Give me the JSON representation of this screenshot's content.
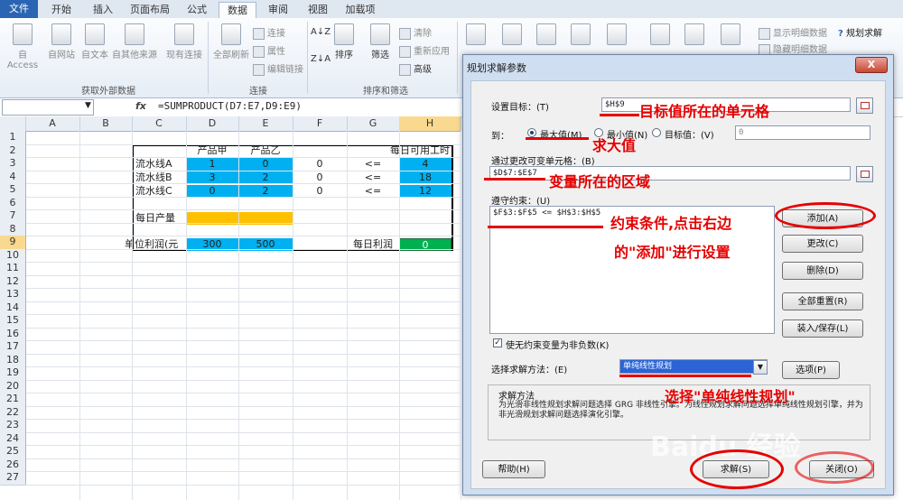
{
  "tabs": [
    "文件",
    "开始",
    "插入",
    "页面布局",
    "公式",
    "数据",
    "审阅",
    "视图",
    "加载项"
  ],
  "ribbon": {
    "get_external": {
      "group": "获取外部数据",
      "items": [
        "自 Access",
        "自网站",
        "自文本",
        "自其他来源",
        "现有连接"
      ]
    },
    "connections": {
      "group": "连接",
      "refresh_all": "全部刷新",
      "items": [
        "连接",
        "属性",
        "编辑链接"
      ]
    },
    "sort_filter": {
      "group": "排序和筛选",
      "sort": "排序",
      "filter": "筛选",
      "items": [
        "清除",
        "重新应用",
        "高级"
      ]
    },
    "outline": {
      "items": [
        "显示明细数据",
        "隐藏明细数据"
      ]
    },
    "solver": "规划求解"
  },
  "formula_bar": {
    "name_box": "",
    "fx": "fx",
    "formula": "=SUMPRODUCT(D7:E7,D9:E9)"
  },
  "columns": [
    "A",
    "B",
    "C",
    "D",
    "E",
    "F",
    "G",
    "H"
  ],
  "rows": [
    "1",
    "2",
    "3",
    "4",
    "5",
    "6",
    "7",
    "8",
    "9",
    "10",
    "11",
    "12",
    "13",
    "14",
    "15",
    "16",
    "17",
    "18",
    "19",
    "20",
    "21",
    "22",
    "23",
    "24",
    "25",
    "26",
    "27"
  ],
  "sheet": {
    "hdr_d": "产品甲",
    "hdr_e": "产品乙",
    "hdr_h": "每日可用工时",
    "line_a": "流水线A",
    "line_b": "流水线B",
    "line_c": "流水线C",
    "d3": "1",
    "e3": "0",
    "f3": "0",
    "g3": "<=",
    "h3": "4",
    "d4": "3",
    "e4": "2",
    "f4": "0",
    "g4": "<=",
    "h4": "18",
    "d5": "0",
    "e5": "2",
    "f5": "0",
    "g5": "<=",
    "h5": "12",
    "daily_output": "每日产量",
    "unit_profit": "单位利润(元",
    "d9": "300",
    "e9": "500",
    "daily_profit": "每日利润",
    "h9": "0"
  },
  "dialog": {
    "title": "规划求解参数",
    "close": "X",
    "target_label": "设置目标：(T)",
    "target_value": "$H$9",
    "to_label": "到：",
    "opt_max": "最大值(M)",
    "opt_min": "最小值(N)",
    "opt_value": "目标值：(V)",
    "value_input": "0",
    "vars_label": "通过更改可变单元格：(B)",
    "vars_value": "$D$7:$E$7",
    "constraints_label": "遵守约束：(U)",
    "constraint_1": "$F$3:$F$5 <= $H$3:$H$5",
    "btn_add": "添加(A)",
    "btn_change": "更改(C)",
    "btn_delete": "删除(D)",
    "btn_reset": "全部重置(R)",
    "btn_load": "装入/保存(L)",
    "nonneg": "使无约束变量为非负数(K)",
    "method_label": "选择求解方法：(E)",
    "method_value": "单纯线性规划",
    "btn_options": "选项(P)",
    "desc_title": "求解方法",
    "desc_text": "为光滑非线性规划求解问题选择 GRG 非线性引擎。为线性规划求解问题选择单纯线性规划引擎，并为非光滑规划求解问题选择演化引擎。",
    "btn_help": "帮助(H)",
    "btn_solve": "求解(S)",
    "btn_close": "关闭(O)"
  },
  "annotations": {
    "target": "目标值所在的单元格",
    "max": "求大值",
    "vars": "变量所在的区域",
    "constraint_1": "约束条件,点击右边",
    "constraint_2": "的\"添加\"进行设置",
    "method": "选择\"单纯线性规划\""
  },
  "watermark": "Baidu 经验",
  "colors": {
    "accent": "#2a64b3",
    "blue_cells": "#00b0f0",
    "gold_cells": "#ffc000",
    "green_cell": "#00b050",
    "annotation": "#e60000"
  }
}
